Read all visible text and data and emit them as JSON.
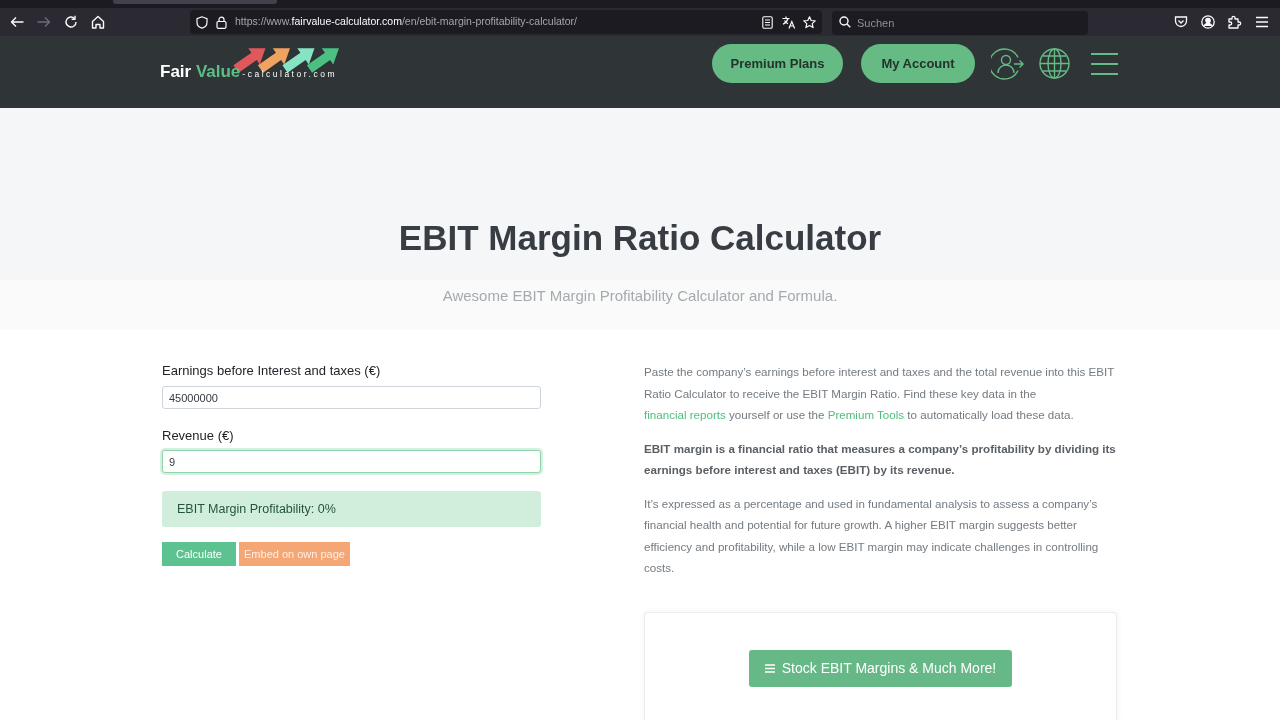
{
  "browser": {
    "nav": [
      {
        "kind": "back",
        "disabled": false
      },
      {
        "kind": "forward",
        "disabled": true
      },
      {
        "kind": "reload",
        "disabled": false
      },
      {
        "kind": "home",
        "disabled": false
      }
    ],
    "address": {
      "prefix": "https://www.",
      "host": "fairvalue-calculator.com",
      "path": "/en/ebit-margin-profitability-calculator/"
    },
    "search": {
      "placeholder": "Suchen"
    }
  },
  "header": {
    "logo": {
      "word_1": "Fair",
      "word_2": "Value",
      "domain": "-calculator.com"
    },
    "buttons": [
      "Premium Plans",
      "My Account"
    ]
  },
  "hero": {
    "title": "EBIT Margin Ratio Calculator",
    "subtitle": "Awesome EBIT Margin Profitability Calculator and Formula."
  },
  "calculator": {
    "fields": [
      {
        "label": "Earnings before Interest and taxes (€)",
        "value": "45000000",
        "focused": false
      },
      {
        "label": "Revenue (€)",
        "value": "9",
        "focused": true
      }
    ],
    "result": "EBIT Margin Profitability: 0%",
    "buttons": [
      {
        "kind": "calculate",
        "label": "Calculate"
      },
      {
        "kind": "embed",
        "label": "Embed on own page"
      }
    ]
  },
  "info": {
    "paragraphs": [
      {
        "kind": "plain",
        "segments": [
          {
            "kind": "text",
            "text": "Paste the company’s earnings before interest and taxes and the total revenue into this EBIT Ratio Calculator to receive the EBIT Margin Ratio. Find these key data in the "
          },
          {
            "kind": "link",
            "text": "financial reports"
          },
          {
            "kind": "text",
            "text": " yourself or use the "
          },
          {
            "kind": "link",
            "text": "Premium Tools"
          },
          {
            "kind": "text",
            "text": " to automatically load these data."
          }
        ]
      },
      {
        "kind": "strong",
        "segments": [
          {
            "kind": "text",
            "text": "EBIT margin is a financial ratio that measures a company’s profitability by dividing its earnings before interest and taxes (EBIT) by its revenue."
          }
        ]
      },
      {
        "kind": "plain",
        "segments": [
          {
            "kind": "text",
            "text": "It’s expressed as a percentage and used in fundamental analysis to assess a company’s financial health and potential for future growth. A higher EBIT margin suggests better efficiency and profitability, while a low EBIT margin may indicate challenges in controlling costs."
          }
        ]
      }
    ]
  },
  "promo": {
    "button": "Stock EBIT Margins & Much More!"
  }
}
